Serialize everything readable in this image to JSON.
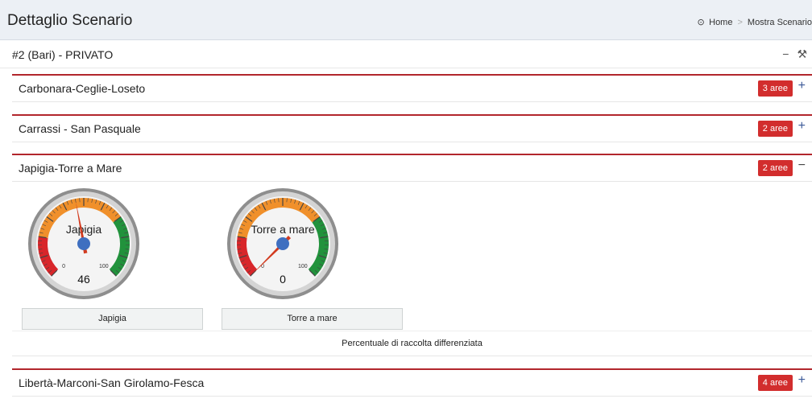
{
  "page": {
    "title": "Dettaglio Scenario",
    "breadcrumb": {
      "home_icon": "tachometer-icon",
      "home": "Home",
      "separator": ">",
      "current": "Mostra Scenario"
    }
  },
  "scenario": {
    "title": "#2 (Bari) - PRIVATO",
    "tools": {
      "collapse": "−",
      "settings_icon": "wrench-icon",
      "settings": "⚒"
    }
  },
  "districts": [
    {
      "name": "Carbonara-Ceglie-Loseto",
      "badge": "3 aree",
      "toggle": "+"
    },
    {
      "name": "Carrassi - San Pasquale",
      "badge": "2 aree",
      "toggle": "+"
    },
    {
      "name": "Japigia-Torre a Mare",
      "badge": "2 aree",
      "toggle": "−"
    },
    {
      "name": "Libertà-Marconi-San Girolamo-Fesca",
      "badge": "4 aree",
      "toggle": "+"
    }
  ],
  "gauges": [
    {
      "label": "Japigia",
      "value": 46,
      "value_text": "46",
      "min": "0",
      "max": "100",
      "button": "Japigia"
    },
    {
      "label": "Torre a mare",
      "value": 0,
      "value_text": "0",
      "min": "0",
      "max": "100",
      "button": "Torre a mare"
    }
  ],
  "gauge_colors": {
    "red": "#d8262a",
    "orange": "#f0902b",
    "green": "#21923c",
    "needle": "#d23b1f",
    "hub": "#3f6fc0"
  },
  "caption": "Percentuale di raccolta differenziata"
}
